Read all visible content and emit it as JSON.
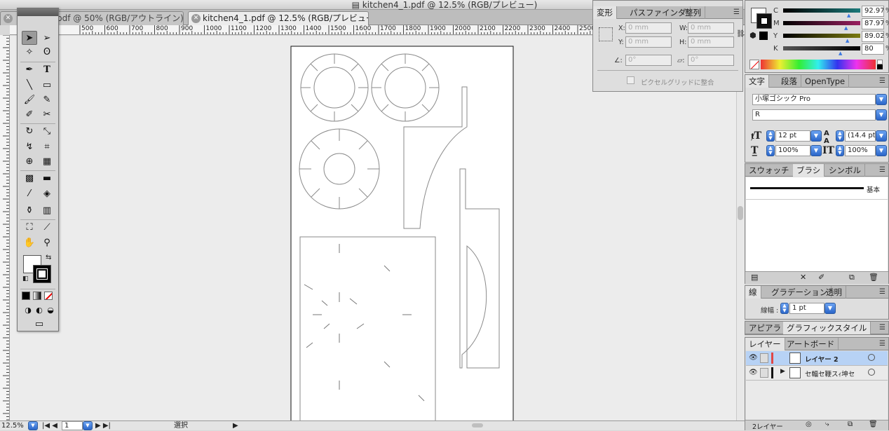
{
  "window": {
    "title": "kitchen4_1.pdf @ 12.5% (RGB/プレビュー)"
  },
  "tabs": [
    {
      "label": "pdf @ 50% (RGB/アウトライン)"
    },
    {
      "label": "kitchen4_1.pdf @ 12.5% (RGB/プレビュー)"
    }
  ],
  "ruler": {
    "top_labels": [
      "500",
      "600",
      "700",
      "800",
      "900",
      "1000",
      "1100",
      "1200",
      "1300",
      "1400",
      "1500",
      "1600",
      "1700",
      "1800",
      "1900",
      "2000",
      "2100",
      "2200",
      "2300",
      "2400",
      "2500"
    ]
  },
  "status": {
    "zoom": "12.5%",
    "page": "1",
    "tool_label": "選択"
  },
  "transform_panel": {
    "tabs": [
      "変形",
      "パスファインダ",
      "整列"
    ],
    "x_label": "X:",
    "x_value": "0 mm",
    "y_label": "Y:",
    "y_value": "0 mm",
    "w_label": "W:",
    "w_value": "0 mm",
    "h_label": "H:",
    "h_value": "0 mm",
    "rotate_value": "0°",
    "shear_value": "0°",
    "pixel_grid_label": "ピクセルグリッドに整合"
  },
  "color_panel": {
    "c_label": "C",
    "c_value": "92.97",
    "m_label": "M",
    "m_value": "87.97",
    "y_label": "Y",
    "y_value": "89.02",
    "k_label": "K",
    "k_value": "80",
    "percent": "%"
  },
  "character_panel": {
    "tabs": [
      "文字",
      "段落",
      "OpenType"
    ],
    "font_family": "小塚ゴシック Pro",
    "font_style": "R",
    "font_size": "12 pt",
    "leading": "(14.4 pt)",
    "horizontal_scale": "100%",
    "vertical_scale": "100%"
  },
  "brush_panel": {
    "tabs": [
      "スウォッチ",
      "ブラシ",
      "シンボル"
    ],
    "brush_name": "基本"
  },
  "stroke_panel": {
    "tabs": [
      "線",
      "グラデーション",
      "透明"
    ],
    "weight_label": "線幅 :",
    "weight_value": "1 pt"
  },
  "appearance_panel": {
    "tabs": [
      "アピアラ",
      "グラフィックスタイル"
    ]
  },
  "layers_panel": {
    "tabs": [
      "レイヤー",
      "アートボード"
    ],
    "layers": [
      {
        "name": "レイヤー 2"
      },
      {
        "name": "セ輻セ鞭スｨ坤セ"
      }
    ],
    "footer_count": "2レイヤー"
  },
  "colors": {
    "accent_blue": "#3a78e0",
    "selected_row": "#b7d2f5",
    "layer_red": "#e04848"
  }
}
